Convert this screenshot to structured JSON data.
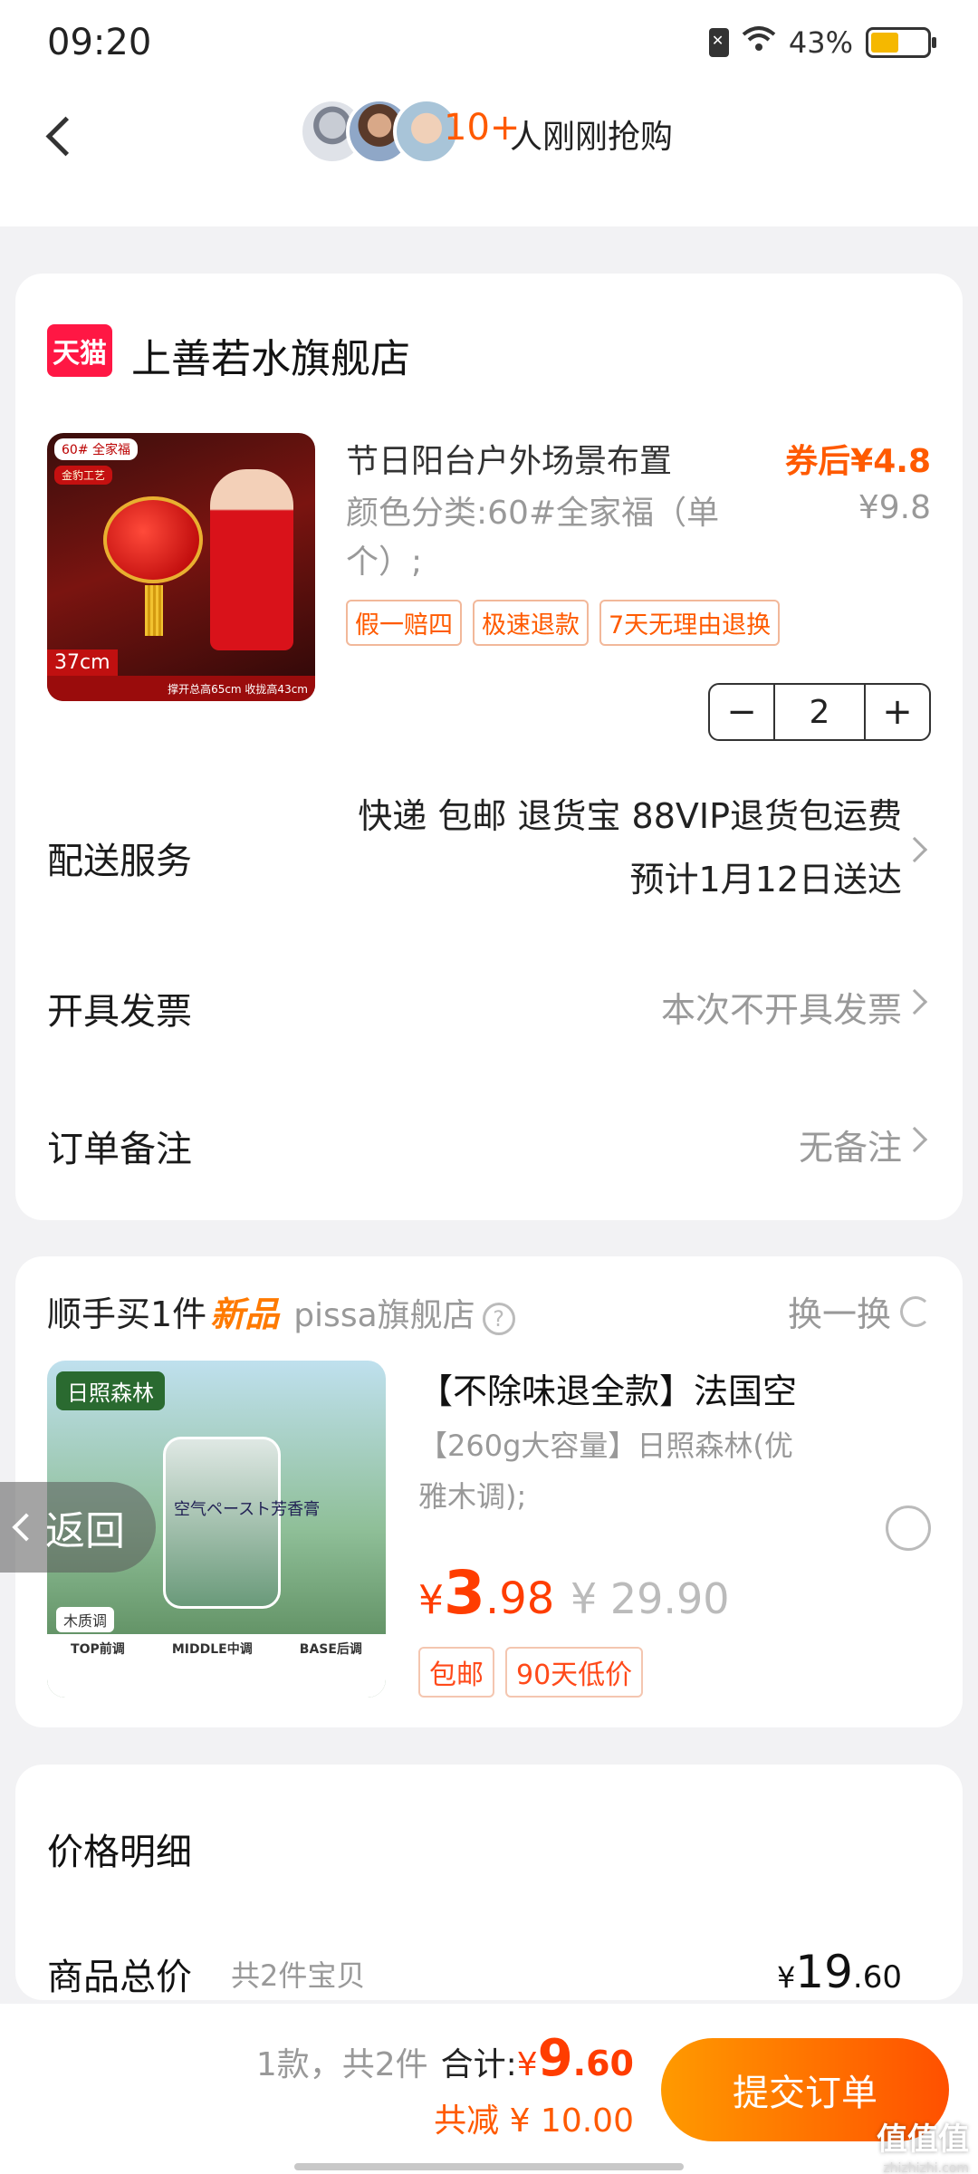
{
  "status_bar": {
    "time": "09:20",
    "battery": "43%"
  },
  "header": {
    "hot_count": "10+",
    "hot_text": "人刚刚抢购"
  },
  "shop": {
    "logo": "天猫",
    "name": "上善若水旗舰店"
  },
  "product": {
    "image_tag": "60# 全家福",
    "image_subtag": "金豹工艺",
    "image_size": "37cm",
    "image_bottom": "撑开总高65cm 收拢高43cm",
    "title": "节日阳台户外场景布置",
    "coupon_price": "券后¥4.8",
    "variant": "颜色分类:60#全家福（单个）;",
    "orig_price": "¥9.8",
    "badges": [
      "假一赔四",
      "极速退款",
      "7天无理由退换"
    ],
    "quantity": "2"
  },
  "rows": {
    "delivery_label": "配送服务",
    "delivery_line1": "快递 包邮 退货宝 88VIP退货包运费",
    "delivery_line2": "预计1月12日送达",
    "invoice_label": "开具发票",
    "invoice_value": "本次不开具发票",
    "note_label": "订单备注",
    "note_value": "无备注"
  },
  "addon": {
    "head": "顺手买1件",
    "new_tag": "新品",
    "shop": "pissa旗舰店",
    "help": "?",
    "swap": "换一换",
    "image_label": "日照森林",
    "image_jar_text": "空气ペースト芳香膏",
    "image_mood": "木质调",
    "image_notes": [
      "TOP前调",
      "MIDDLE中调",
      "BASE后调"
    ],
    "title": "【不除味退全款】法国空",
    "variant": "【260g大容量】日照森林(优雅木调);",
    "price_yen": "¥",
    "price_int": "3",
    "price_dec": ".98",
    "orig_price": "¥ 29.90",
    "badges": [
      "包邮",
      "90天低价"
    ]
  },
  "float_back": "返回",
  "price_detail": {
    "title": "价格明细",
    "goods_label": "商品总价",
    "goods_count": "共2件宝贝",
    "total_yen": "¥",
    "total_int": "19",
    "total_dec": ".60"
  },
  "footer": {
    "count": "1款，共2件",
    "sum_label": "合计:",
    "sum_yen": "¥",
    "sum_int": "9",
    "sum_dec": ".60",
    "saving": "共减 ¥ 10.00",
    "submit": "提交订单",
    "watermark": "值值值",
    "watermark_sub": "zhizhizhi.com"
  },
  "colors": {
    "accent": "#ff5a00",
    "price_red": "#ff3d00",
    "tmall_red": "#ff1744"
  }
}
